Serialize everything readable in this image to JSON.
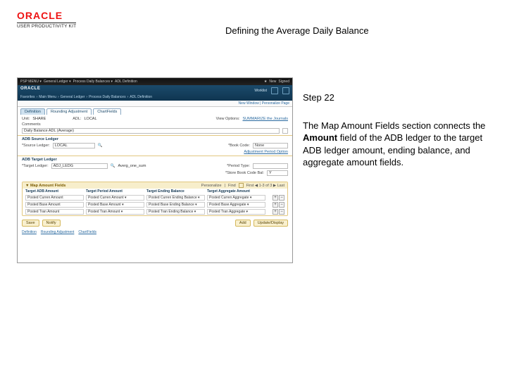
{
  "header": {
    "brand": "ORACLE",
    "product": "USER PRODUCTIVITY KIT",
    "page_title": "Defining the Average Daily Balance"
  },
  "instructions": {
    "step_label": "Step 22",
    "body_pre": "The Map Amount Fields section connects the ",
    "body_bold": "Amount",
    "body_post": " field of the ADB ledger to the target ADB ledger amount, ending balance, and aggregate amount fields."
  },
  "screenshot": {
    "topbar": {
      "left": [
        "",
        "PSP MENU ▾",
        "General Ledger ▾",
        "Process Daily Balances ▾",
        "ADL Definition"
      ],
      "right_labels": [
        "New",
        "Signed"
      ]
    },
    "bluebar": {
      "brand": "ORACLE",
      "crumbs": [
        "Favorites",
        "Main Menu",
        "General Ledger",
        "Process Daily Balances",
        "ADL Definition"
      ],
      "tool_labels": [
        "Worklist",
        "Worklist"
      ]
    },
    "subbar": "New Window | Personalize Page",
    "tabs": [
      "Definition",
      "Rounding Adjustment",
      "ChartFields"
    ],
    "form1": {
      "unit_label": "Unit:",
      "unit_value": "SHARE",
      "adl_label": "ADL:",
      "adl_value": "LOCAL",
      "viewopt_label": "View Options:",
      "viewopt_value": "SUMMARIZE the Journals",
      "comments_label": "Comments",
      "comments_value": "Daily Balance ADL (Average)"
    },
    "ledger_panel": {
      "heading": "ADB Source Ledger",
      "source_ledger_label": "*Source Ledger:",
      "source_ledger_value": "LOCAL",
      "q_icon": "🔍",
      "bookcode_label": "*Book Code:",
      "bookcode_value": "None",
      "adjopt_label": "Adjustment Period Option"
    },
    "target_panel": {
      "heading": "ADB Target Ledger",
      "target_ledger_label": "*Target Ledger:",
      "target_ledger_value": "ADJ_LEDG",
      "q_icon": "🔍",
      "desc_value": "Averg_one_sum",
      "pertype_label": "*Period Type:",
      "codebal_label": "*Store Book Code Bal:",
      "codebal_value": "Y"
    },
    "map": {
      "heading": "▼ Map Amount Fields",
      "right_head": [
        "Personalize",
        "Find",
        "",
        "First ◀ 1-3 of 3 ▶ Last"
      ],
      "columns": [
        "Target ADB Amount",
        "Target Period Amount",
        "Target Ending Balance",
        "Target Aggregate Amount",
        ""
      ],
      "rows": [
        [
          "Posted Curren Amount",
          "Posted Curren Amount ▾",
          "Posted Curren Ending Balance ▾",
          "Posted Curren Aggregate ▾"
        ],
        [
          "Posted Base Amount",
          "Posted Base Amount ▾",
          "Posted Base Ending Balance ▾",
          "Posted Base Aggregate ▾"
        ],
        [
          "Posted Tran Amount",
          "Posted Tran Amount ▾",
          "Posted Tran Ending Balance ▾",
          "Posted Tran Aggregate ▾"
        ]
      ],
      "plus": "+",
      "minus": "−"
    },
    "footer": {
      "save": "Save",
      "notify": "Notify",
      "add": "Add",
      "update": "Update/Display"
    },
    "links": [
      "Definition",
      "Rounding Adjustment",
      "ChartFields"
    ]
  }
}
